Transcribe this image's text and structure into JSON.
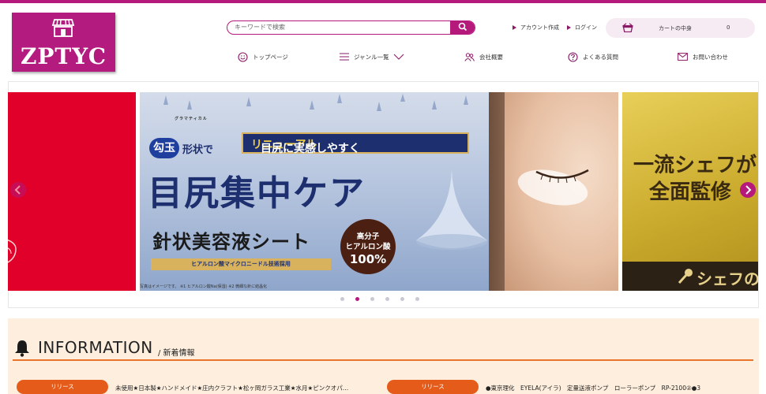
{
  "logo": {
    "text": "ZPTYC",
    "icon": "storefront-icon"
  },
  "search": {
    "placeholder": "キーワードで検索",
    "value": "",
    "button_icon": "search-icon"
  },
  "account": {
    "create_label": "アカウント作成",
    "login_label": "ログイン"
  },
  "cart": {
    "label": "カートの中身",
    "count": "0",
    "icon": "cart-icon"
  },
  "nav": [
    {
      "label": "トップページ",
      "icon": "smile-icon"
    },
    {
      "label": "ジャンル一覧",
      "icon": "menu-icon"
    },
    {
      "label": "会社概要",
      "icon": "people-icon"
    },
    {
      "label": "よくある質問",
      "icon": "question-icon"
    },
    {
      "label": "お問い合わせ",
      "icon": "mail-icon"
    }
  ],
  "banner": {
    "brand": "グラマティカル",
    "magatama": "勾玉",
    "shape_text": "形状で",
    "renewal_pre": "目尻に実感しやすく",
    "renewal_hl": "リニューアル",
    "title": "目尻集中ケア",
    "sheet": "針状美容液シート",
    "tech": "ヒアルロン酸マイクロニードル技術採用",
    "badge_l1": "高分子",
    "badge_l2": "ヒアルロン酸",
    "badge_l3": "100%",
    "footnote": "写真はイメージです。 ※1 ヒアルロン酸Na(保湿) ※2 微細な針に結晶化"
  },
  "banner_right": {
    "line1": "一流シェフが",
    "line2": "全面監修",
    "bottom": "シェフの"
  },
  "slider": {
    "dot_count": 6,
    "active_index": 1
  },
  "information": {
    "title": "INFORMATION",
    "subtitle": "/ 新着情報",
    "items": [
      {
        "tag": "リリース",
        "text": "未使用★日本製★ハンドメイド★庄内クラフト★松ヶ岡ガラス工業★水月★ピンクオパ…"
      },
      {
        "tag": "リリース",
        "text": "●東京理化　EYELA(アイラ)　定量送液ポンプ　ローラーポンプ　RP-2100②●3"
      }
    ]
  },
  "colors": {
    "brand": "#b5197c",
    "accent": "#e55b1a",
    "info_bg": "#fdeedd"
  }
}
